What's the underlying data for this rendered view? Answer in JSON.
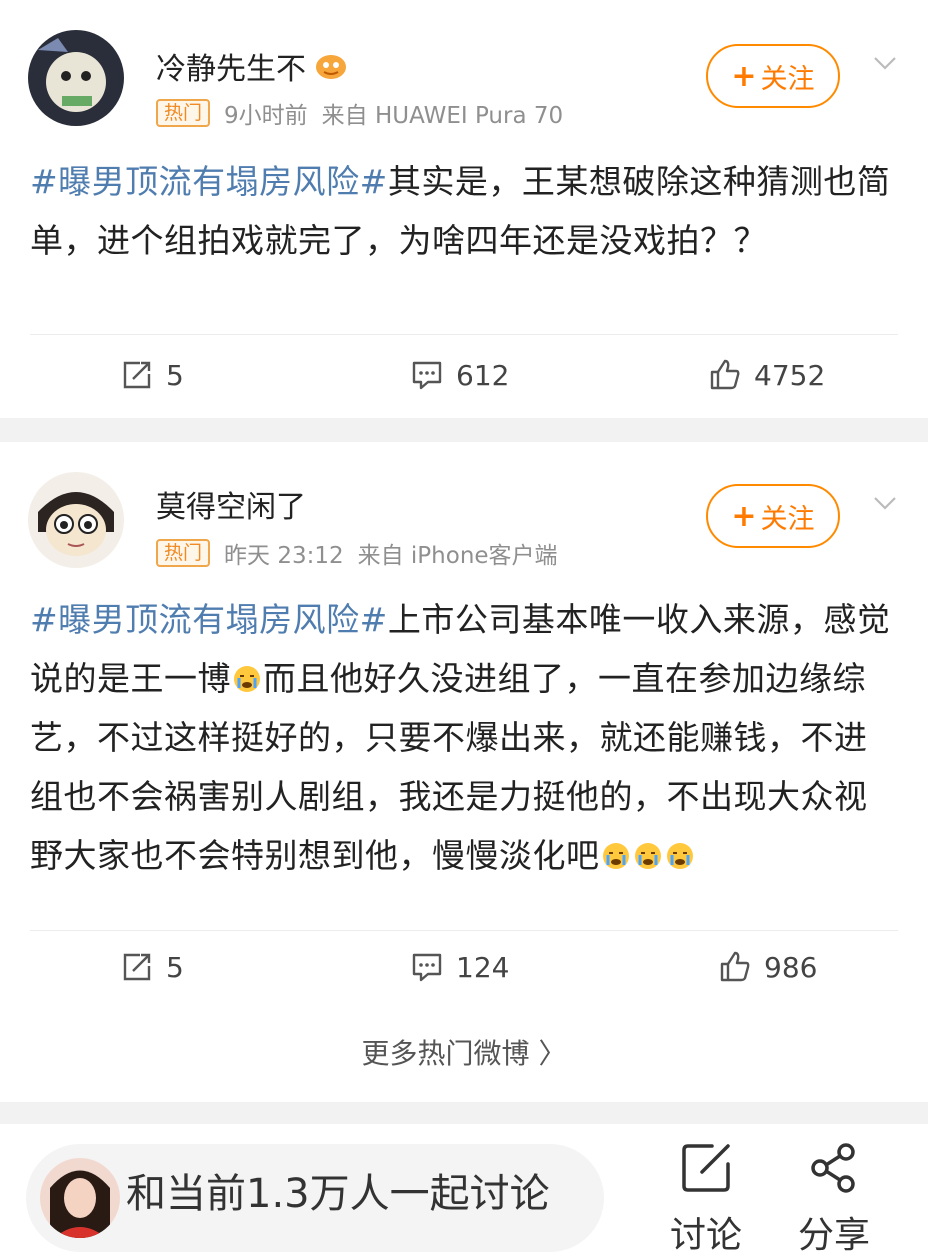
{
  "posts": [
    {
      "username": "冷静先生不",
      "hot_badge": "热门",
      "time": "9小时前",
      "source": "来自 HUAWEI Pura 70",
      "follow_label": "关注",
      "topic": "#曝男顶流有塌房风险#",
      "text": "其实是，王某想破除这种猜测也简单，进个组拍戏就完了，为啥四年还是没戏拍？？",
      "reposts": "5",
      "comments": "612",
      "likes": "4752"
    },
    {
      "username": "莫得空闲了",
      "hot_badge": "热门",
      "time": "昨天 23:12",
      "source": "来自 iPhone客户端",
      "follow_label": "关注",
      "topic": "#曝男顶流有塌房风险#",
      "text_part1": "上市公司基本唯一收入来源，感觉说的是王一博",
      "text_part2": "而且他好久没进组了，一直在参加边缘综艺，不过这样挺好的，只要不爆出来，就还能赚钱，不进组也不会祸害别人剧组，我还是力挺他的，不出现大众视野大家也不会特别想到他，慢慢淡化吧",
      "reposts": "5",
      "comments": "124",
      "likes": "986"
    }
  ],
  "more_hot_label": "更多热门微博 〉",
  "bottom_bar": {
    "discuss_text": "和当前1.3万人一起讨论",
    "comment_label": "讨论",
    "share_label": "分享"
  },
  "colors": {
    "topic_blue": "#507daf",
    "follow_orange": "#ff7a00",
    "hot_badge": "#f08a24"
  },
  "icons": [
    "repost-icon",
    "comment-icon",
    "like-icon",
    "chevron-down-icon",
    "vip-badge-icon",
    "crying-emoji-icon",
    "edit-icon",
    "share-icon"
  ]
}
